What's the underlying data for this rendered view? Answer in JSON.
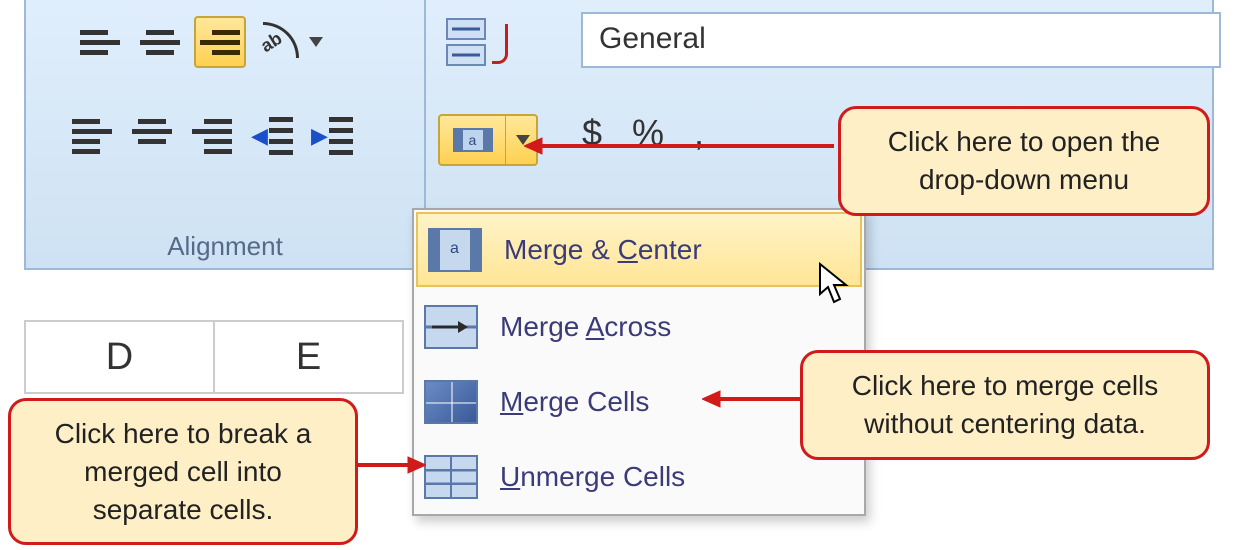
{
  "ribbon": {
    "group_label": "Alignment",
    "number_format": "General",
    "number_symbols": "$ % ,"
  },
  "merge_dropdown": {
    "items": [
      {
        "label_pre": "Merge & ",
        "key": "C",
        "label_post": "enter",
        "highlighted": true,
        "icon": "merge-center"
      },
      {
        "label_pre": "Merge ",
        "key": "A",
        "label_post": "cross",
        "highlighted": false,
        "icon": "merge-across"
      },
      {
        "label_pre": "",
        "key": "M",
        "label_post": "erge Cells",
        "highlighted": false,
        "icon": "merge-cells"
      },
      {
        "label_pre": "",
        "key": "U",
        "label_post": "nmerge Cells",
        "highlighted": false,
        "icon": "unmerge"
      }
    ]
  },
  "grid": {
    "headers": [
      "D",
      "E"
    ]
  },
  "callouts": {
    "open_menu": "Click here to open the drop-down menu",
    "merge_no_center": "Click here to merge cells without centering data.",
    "unmerge": "Click here to break a merged cell into separate cells."
  }
}
